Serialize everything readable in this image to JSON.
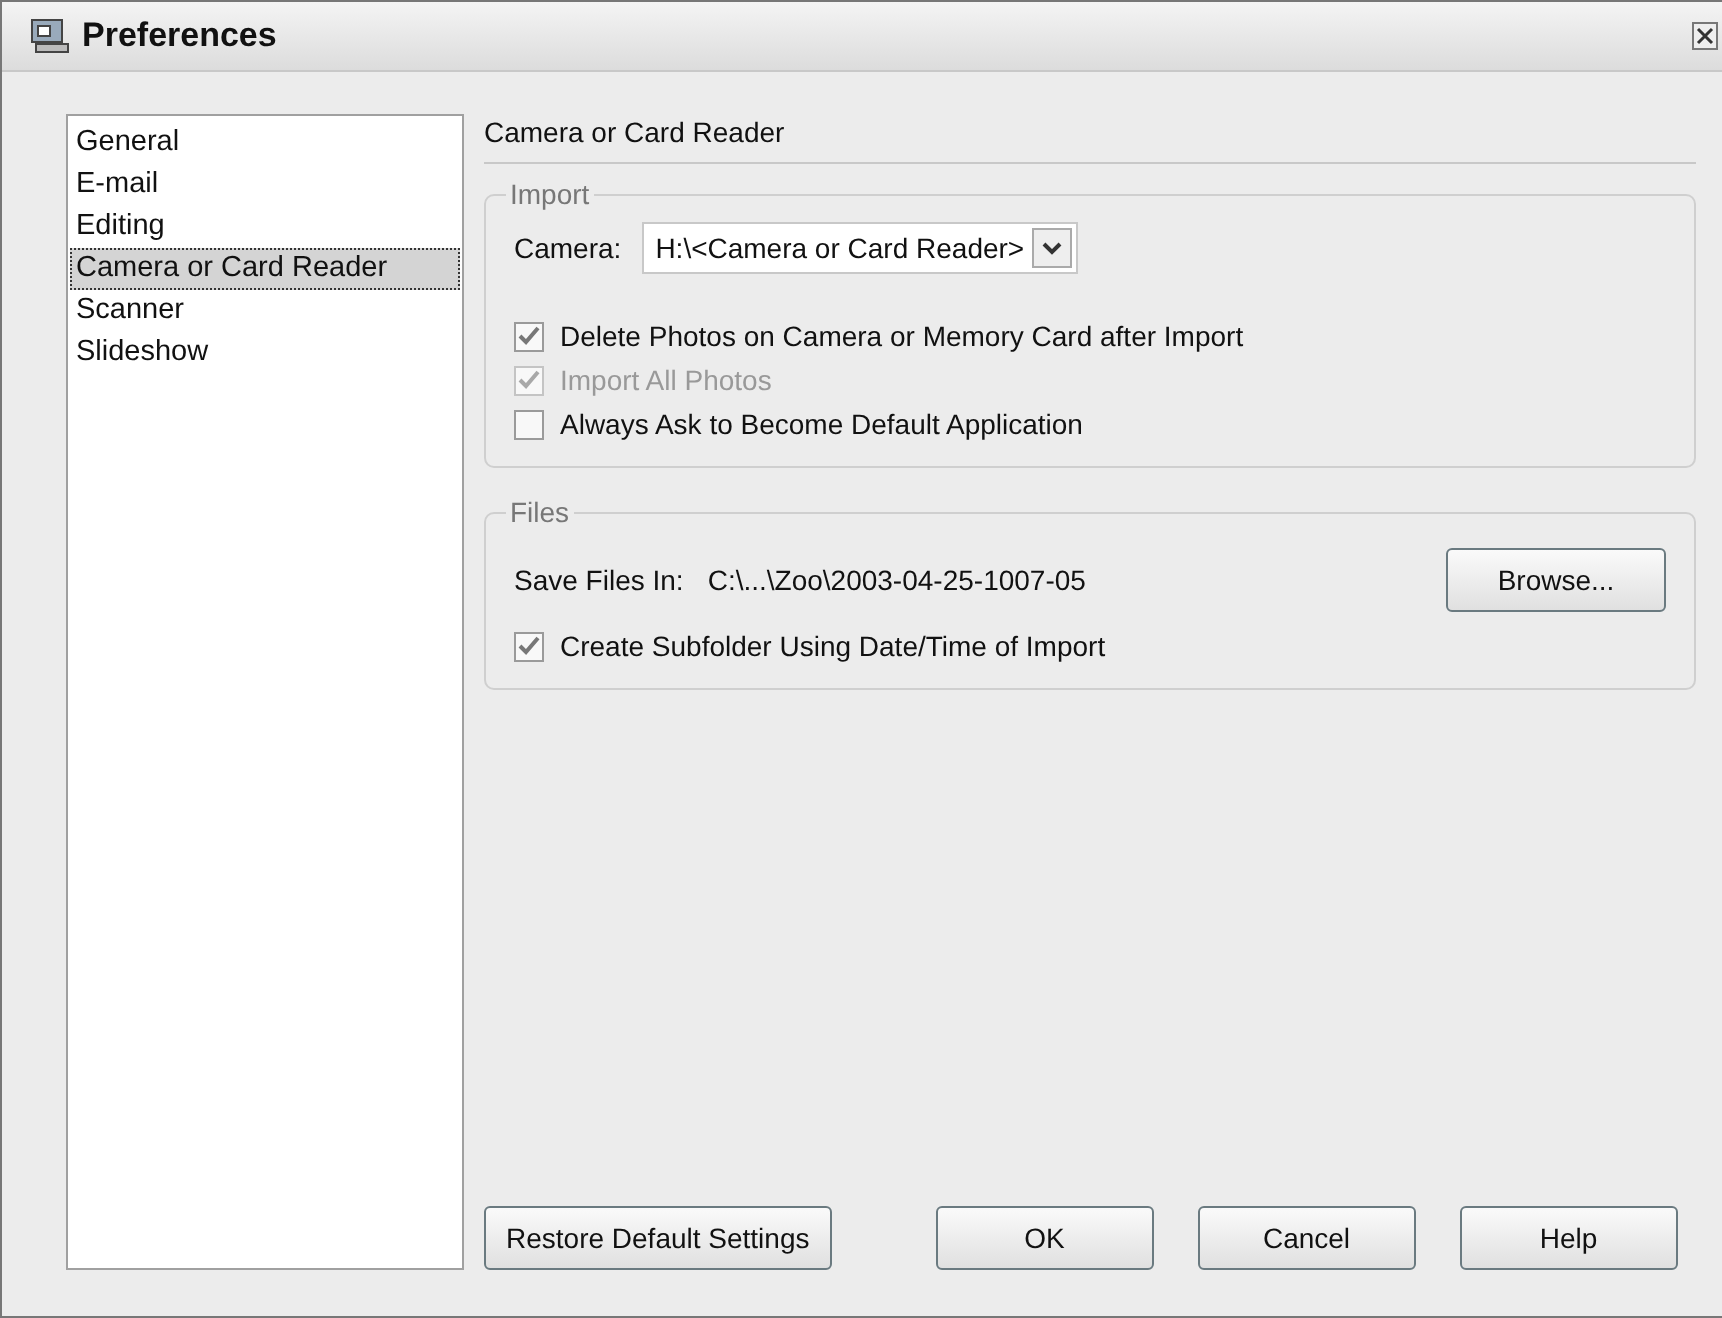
{
  "window": {
    "title": "Preferences"
  },
  "sidebar": {
    "items": [
      {
        "label": "General",
        "selected": false
      },
      {
        "label": "E-mail",
        "selected": false
      },
      {
        "label": "Editing",
        "selected": false
      },
      {
        "label": "Camera or Card Reader",
        "selected": true
      },
      {
        "label": "Scanner",
        "selected": false
      },
      {
        "label": "Slideshow",
        "selected": false
      }
    ]
  },
  "panel": {
    "title": "Camera or Card Reader",
    "import_group": {
      "title": "Import",
      "camera": {
        "label": "Camera:",
        "value": "H:\\<Camera or Card Reader>"
      },
      "options": [
        {
          "label": "Delete Photos on Camera or Memory Card after Import",
          "checked": true,
          "disabled": false
        },
        {
          "label": "Import All Photos",
          "checked": true,
          "disabled": true
        },
        {
          "label": "Always Ask to Become Default Application",
          "checked": false,
          "disabled": false
        }
      ]
    },
    "files_group": {
      "title": "Files",
      "save_label": "Save Files In:",
      "save_path": "C:\\...\\Zoo\\2003-04-25-1007-05",
      "browse": "Browse...",
      "options": [
        {
          "label": "Create Subfolder Using Date/Time of Import",
          "checked": true,
          "disabled": false
        }
      ]
    }
  },
  "buttons": {
    "restore": "Restore Default Settings",
    "actions": [
      "OK",
      "Cancel",
      "Help"
    ]
  }
}
